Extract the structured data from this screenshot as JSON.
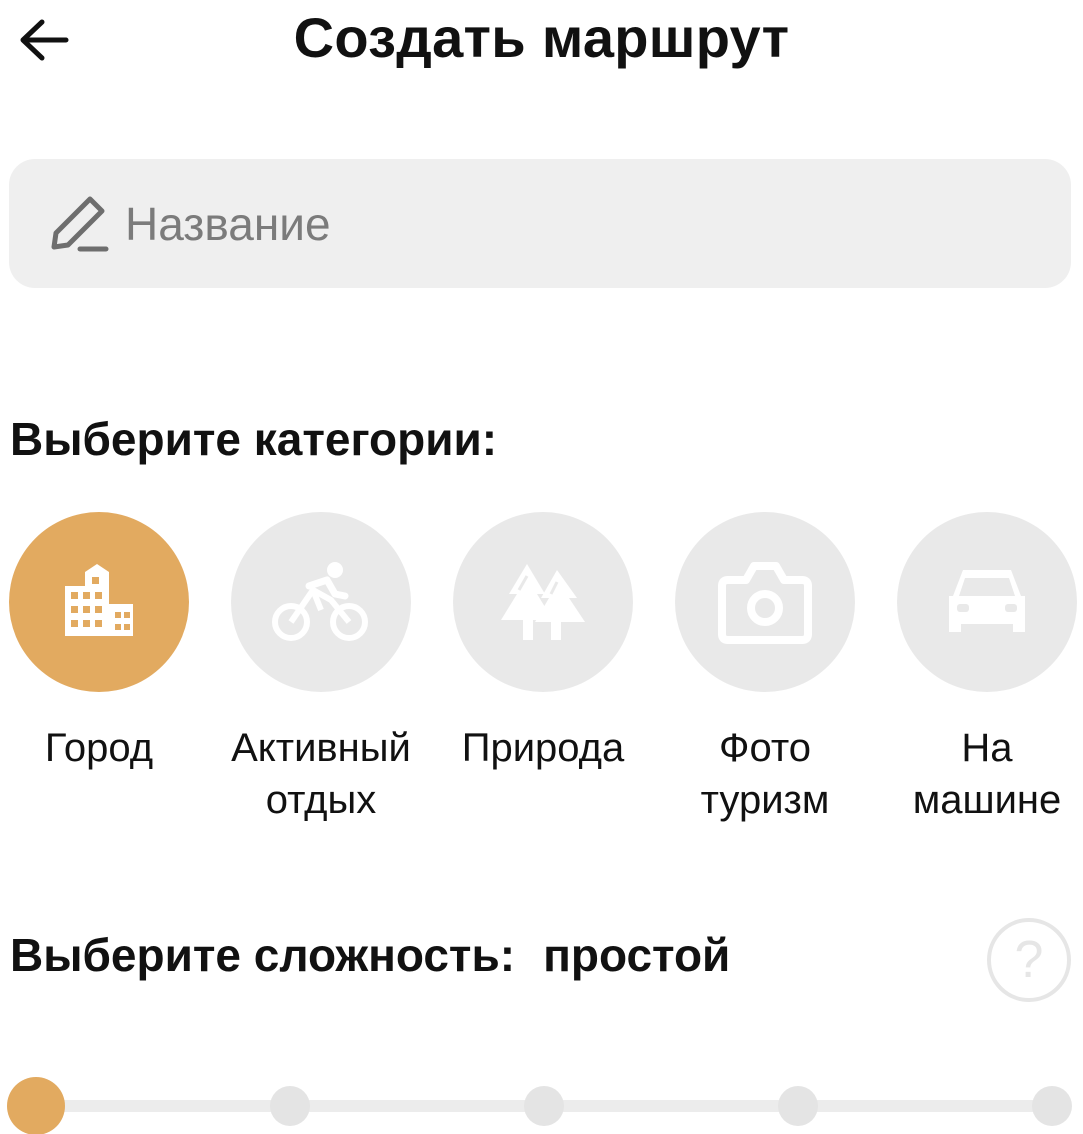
{
  "header": {
    "title": "Создать маршрут",
    "back_icon": "arrow-left-icon"
  },
  "name_field": {
    "value": "",
    "placeholder": "Название",
    "icon": "pencil-icon"
  },
  "categories": {
    "heading": "Выберите категории:",
    "items": [
      {
        "label": "Город",
        "icon": "city-building-icon",
        "selected": true
      },
      {
        "label": "Активный\nотдых",
        "icon": "bicycle-icon",
        "selected": false
      },
      {
        "label": "Природа",
        "icon": "trees-icon",
        "selected": false
      },
      {
        "label": "Фото\nтуризм",
        "icon": "camera-icon",
        "selected": false
      },
      {
        "label": "На\nмашине",
        "icon": "car-icon",
        "selected": false
      }
    ]
  },
  "difficulty": {
    "heading": "Выберите сложность:",
    "value": "простой",
    "help_icon": "question-circle-icon",
    "help_symbol": "?",
    "levels": 5,
    "selected_index": 0
  },
  "colors": {
    "accent": "#e2aa60",
    "inactive": "#e9e9e9",
    "field_bg": "#efefef"
  }
}
